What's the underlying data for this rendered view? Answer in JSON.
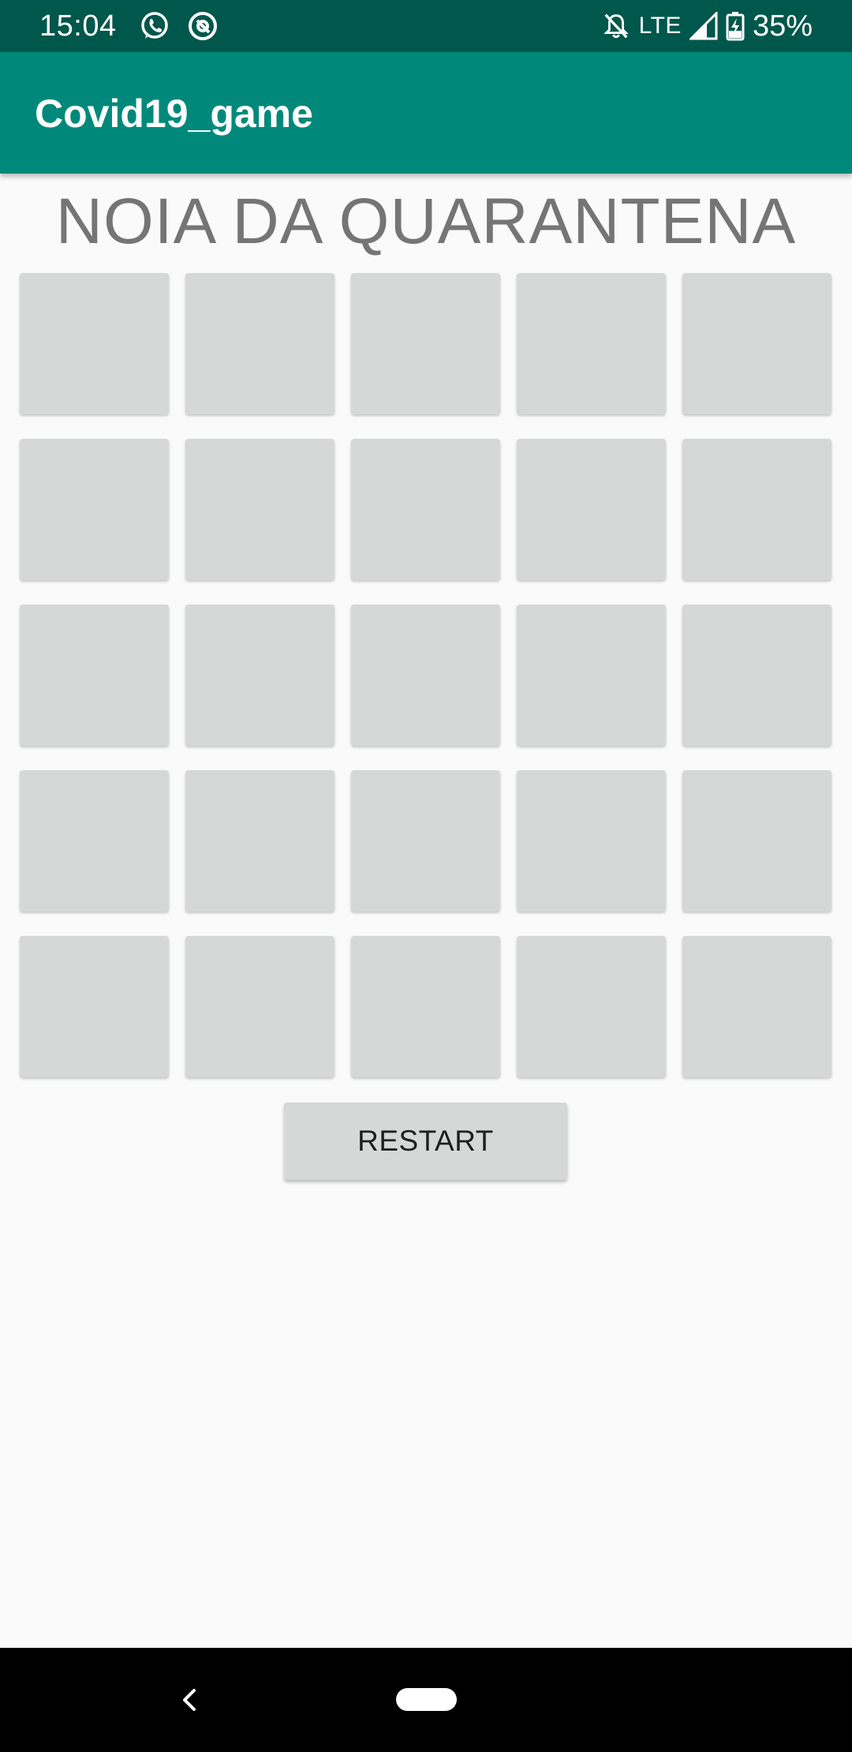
{
  "status_bar": {
    "time": "15:04",
    "left_icons": [
      "whatsapp-icon",
      "signal-app-icon"
    ],
    "right_icons": [
      "notifications-off-icon",
      "cell-signal-icon",
      "battery-charging-icon"
    ],
    "network": "LTE",
    "battery": "35%"
  },
  "app_bar": {
    "title": "Covid19_game",
    "color": "#00897b"
  },
  "game": {
    "heading": "NOIA DA QUARANTENA",
    "rows": 5,
    "columns": 5,
    "tile_color": "#d6d7d7",
    "restart_label": "RESTART"
  },
  "nav_bar": {
    "icons": [
      "back-icon",
      "home-pill"
    ]
  }
}
